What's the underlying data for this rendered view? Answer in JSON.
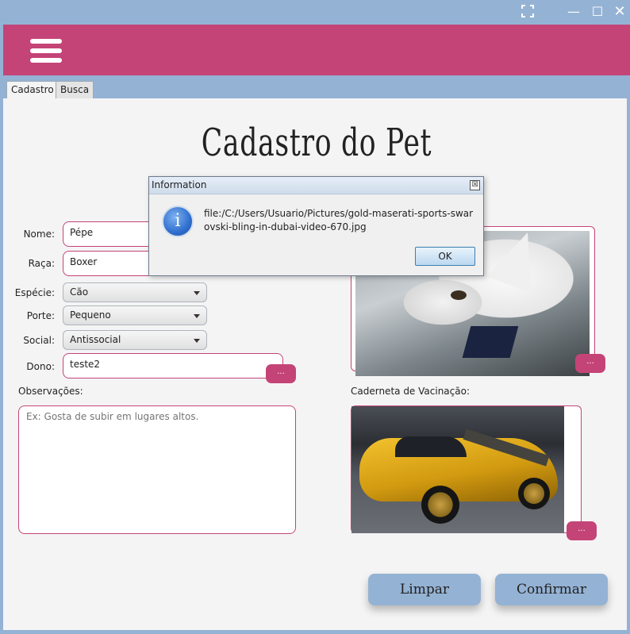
{
  "window": {
    "expand_icon": "expand-icon",
    "minimize_glyph": "—",
    "maximize_glyph": "☐",
    "close_glyph": "✕"
  },
  "header": {
    "color": "#c44477",
    "menu_icon": "hamburger-menu-icon"
  },
  "tabs": [
    {
      "label": "Cadastro",
      "active": true
    },
    {
      "label": "Busca",
      "active": false
    }
  ],
  "form": {
    "title": "Cadastro do Pet",
    "nome": {
      "label": "Nome:",
      "value": "Pépe"
    },
    "raca": {
      "label": "Raça:",
      "value": "Boxer"
    },
    "especie": {
      "label": "Espécie:",
      "value": "Cão"
    },
    "porte": {
      "label": "Porte:",
      "value": "Pequeno"
    },
    "social": {
      "label": "Social:",
      "value": "Antissocial"
    },
    "dono": {
      "label": "Dono:",
      "value": "teste2",
      "button": "..."
    },
    "observacoes": {
      "label": "Observações:",
      "placeholder": "Ex: Gosta de subir em lugares altos."
    },
    "photo_button": "...",
    "vacinacao": {
      "label": "Caderneta de Vacinação:",
      "button": "..."
    }
  },
  "actions": {
    "limpar": "Limpar",
    "confirmar": "Confirmar"
  },
  "dialog": {
    "title": "Information",
    "close_glyph": "☒",
    "icon_glyph": "i",
    "message": "file:/C:/Users/Usuario/Pictures/gold-maserati-sports-swarovski-bling-in-dubai-video-670.jpg",
    "ok": "OK"
  },
  "colors": {
    "accent": "#c44477",
    "frame": "#94b2d4",
    "background": "#f4f4f4"
  }
}
